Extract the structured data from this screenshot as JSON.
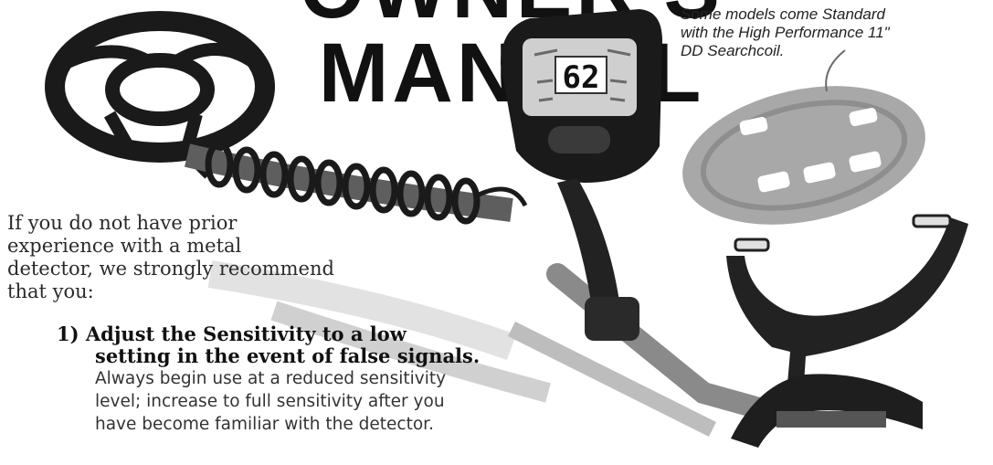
{
  "page": {
    "title": "OWNER'S MANUAL"
  },
  "caption": {
    "lines": [
      "Some models come Standard",
      "with the High Performance 11\"",
      "DD Searchcoil."
    ]
  },
  "display": {
    "reading": "62"
  },
  "intro": {
    "lines": [
      "If you do not have prior",
      "experience with a metal",
      "detector, we strongly recommend",
      "that you:"
    ]
  },
  "step1": {
    "heading_lines": [
      "1) Adjust the Sensitivity to a low",
      "setting in the event of false signals."
    ],
    "body_lines": [
      "Always begin use at a reduced sensitivity",
      "level; increase to full sensitivity after you",
      "have become familiar with the detector."
    ]
  },
  "colors": {
    "ink": "#111111",
    "body_text": "#333333",
    "coil_gray": "#a8a8a8",
    "detector_black": "#1a1a1a",
    "shaft_gray": "#7a7a7a"
  }
}
